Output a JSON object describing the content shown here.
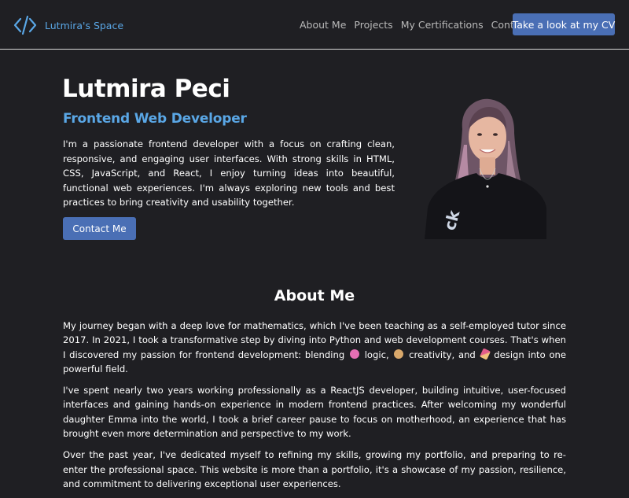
{
  "nav": {
    "brand": "Lutmira's Space",
    "logo_icon": "code-brackets-icon",
    "links": [
      "About Me",
      "Projects",
      "My Certifications",
      "Contact"
    ],
    "cv_button": "Take a look at my CV"
  },
  "hero": {
    "name": "Lutmira Peci",
    "role": "Frontend Web Developer",
    "intro": "I'm a passionate frontend developer with a focus on crafting clean, responsive, and engaging user interfaces. With strong skills in HTML, CSS, JavaScript, and React, I enjoy turning ideas into beautiful, functional web experiences. I'm always exploring new tools and best practices to bring creativity and usability together.",
    "contact_button": "Contact Me",
    "portrait_alt_shirt_text": "ck"
  },
  "about": {
    "title": "About Me",
    "p1_a": "My journey began with a deep love for mathematics, which I've been teaching as a self-employed tutor since 2017. In 2021, I took a transformative step by diving into Python and web development courses. That's when I discovered my passion for frontend development: blending",
    "p1_b": "logic,",
    "p1_c": "creativity, and",
    "p1_d": "design into one powerful field.",
    "p2": "I've spent nearly two years working professionally as a ReactJS developer, building intuitive, user-focused interfaces and gaining hands-on experience in modern frontend practices. After welcoming my wonderful daughter Emma into the world, I took a brief career pause to focus on motherhood, an experience that has brought even more determination and perspective to my work.",
    "p3": "Over the past year, I've dedicated myself to refining my skills, growing my portfolio, and preparing to re-enter the professional space. This website is more than a portfolio, it's a showcase of my passion, resilience, and commitment to delivering exceptional user experiences."
  },
  "colors": {
    "background": "#1f1f23",
    "accent_blue": "#5aa7e6",
    "button_blue": "#4a6fb5"
  }
}
